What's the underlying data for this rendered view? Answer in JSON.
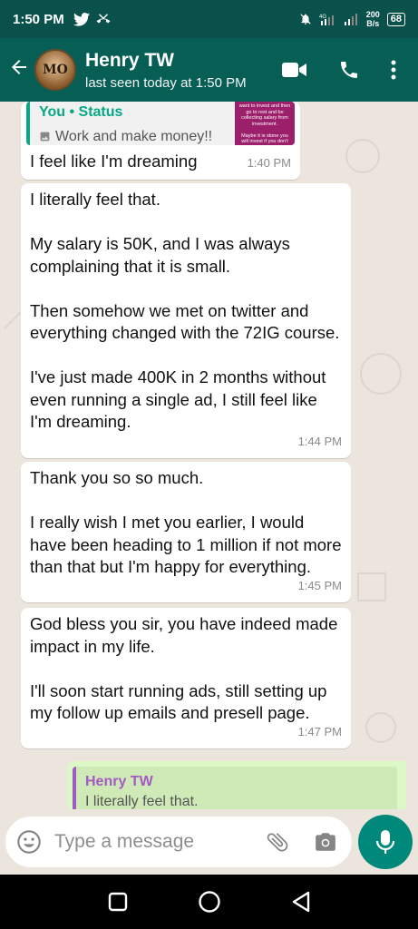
{
  "status_bar": {
    "time": "1:50 PM",
    "left_icons": [
      "twitter-icon",
      "missed-call-icon"
    ],
    "right_icons": [
      "mute-icon",
      "signal-4g-icon",
      "signal-icon"
    ],
    "net_speed_value": "200",
    "net_speed_unit": "B/s",
    "battery": "68"
  },
  "header": {
    "contact_name": "Henry TW",
    "last_seen": "last seen today at 1:50 PM",
    "avatar_text": "MO"
  },
  "messages": [
    {
      "reply_to": {
        "title": "You • Status",
        "text": "Work and make money!!",
        "thumb_text": "want to invest and then go to rest and be collecting salary from investment.\n\nMaybe it is stone you will invest if you don't"
      },
      "text": "I feel like I'm dreaming",
      "time": "1:40 PM"
    },
    {
      "text": "I literally feel that.\n\nMy salary is 50K, and I was always complaining that it is small.\n\nThen somehow we met on twitter and everything changed with the 72IG course.\n\nI've just made 400K in 2 months without even running a single ad, I still feel like I'm dreaming.",
      "time": "1:44 PM"
    },
    {
      "text": "Thank you so so much.\n\nI really wish I met you earlier, I would have been heading to 1 million if not more than that but I'm happy for everything.",
      "time": "1:45 PM"
    },
    {
      "text": "God bless you sir, you have indeed made impact in my life.\n\nI'll soon start running ads, still setting up my follow up emails and presell page.",
      "time": "1:47 PM"
    }
  ],
  "outgoing_preview": {
    "quote_name": "Henry TW",
    "quote_text": "I literally feel that."
  },
  "input": {
    "placeholder": "Type a message"
  },
  "colors": {
    "header": "#075e54",
    "status_bar": "#09514a",
    "accent": "#00897b",
    "chat_bg": "#ece5dd",
    "outgoing_bubble": "#dcf8c6"
  }
}
